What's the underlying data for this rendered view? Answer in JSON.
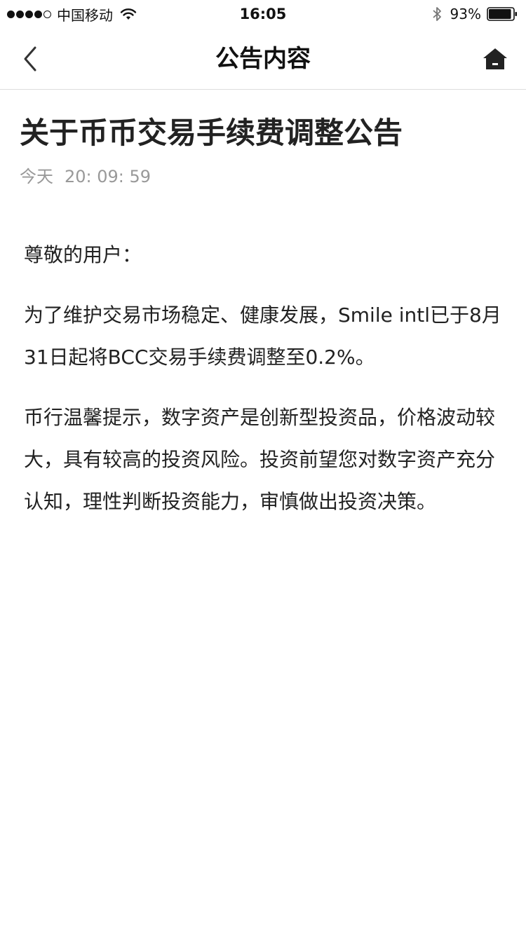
{
  "status_bar": {
    "carrier": "中国移动",
    "time": "16:05",
    "battery": "93%",
    "battery_level": 0.93
  },
  "nav": {
    "title": "公告内容",
    "back_icon": "chevron-left-icon",
    "home_icon": "home-icon"
  },
  "article": {
    "title": "关于币币交易手续费调整公告",
    "date": "今天",
    "time": "20: 09: 59",
    "greeting": "尊敬的用户：",
    "paragraphs": [
      "为了维护交易市场稳定、健康发展，Smile intl已于8月31日起将BCC交易手续费调整至0.2%。",
      "币行温馨提示，数字资产是创新型投资品，价格波动较大，具有较高的投资风险。投资前望您对数字资产充分认知，理性判断投资能力，审慎做出投资决策。"
    ]
  }
}
